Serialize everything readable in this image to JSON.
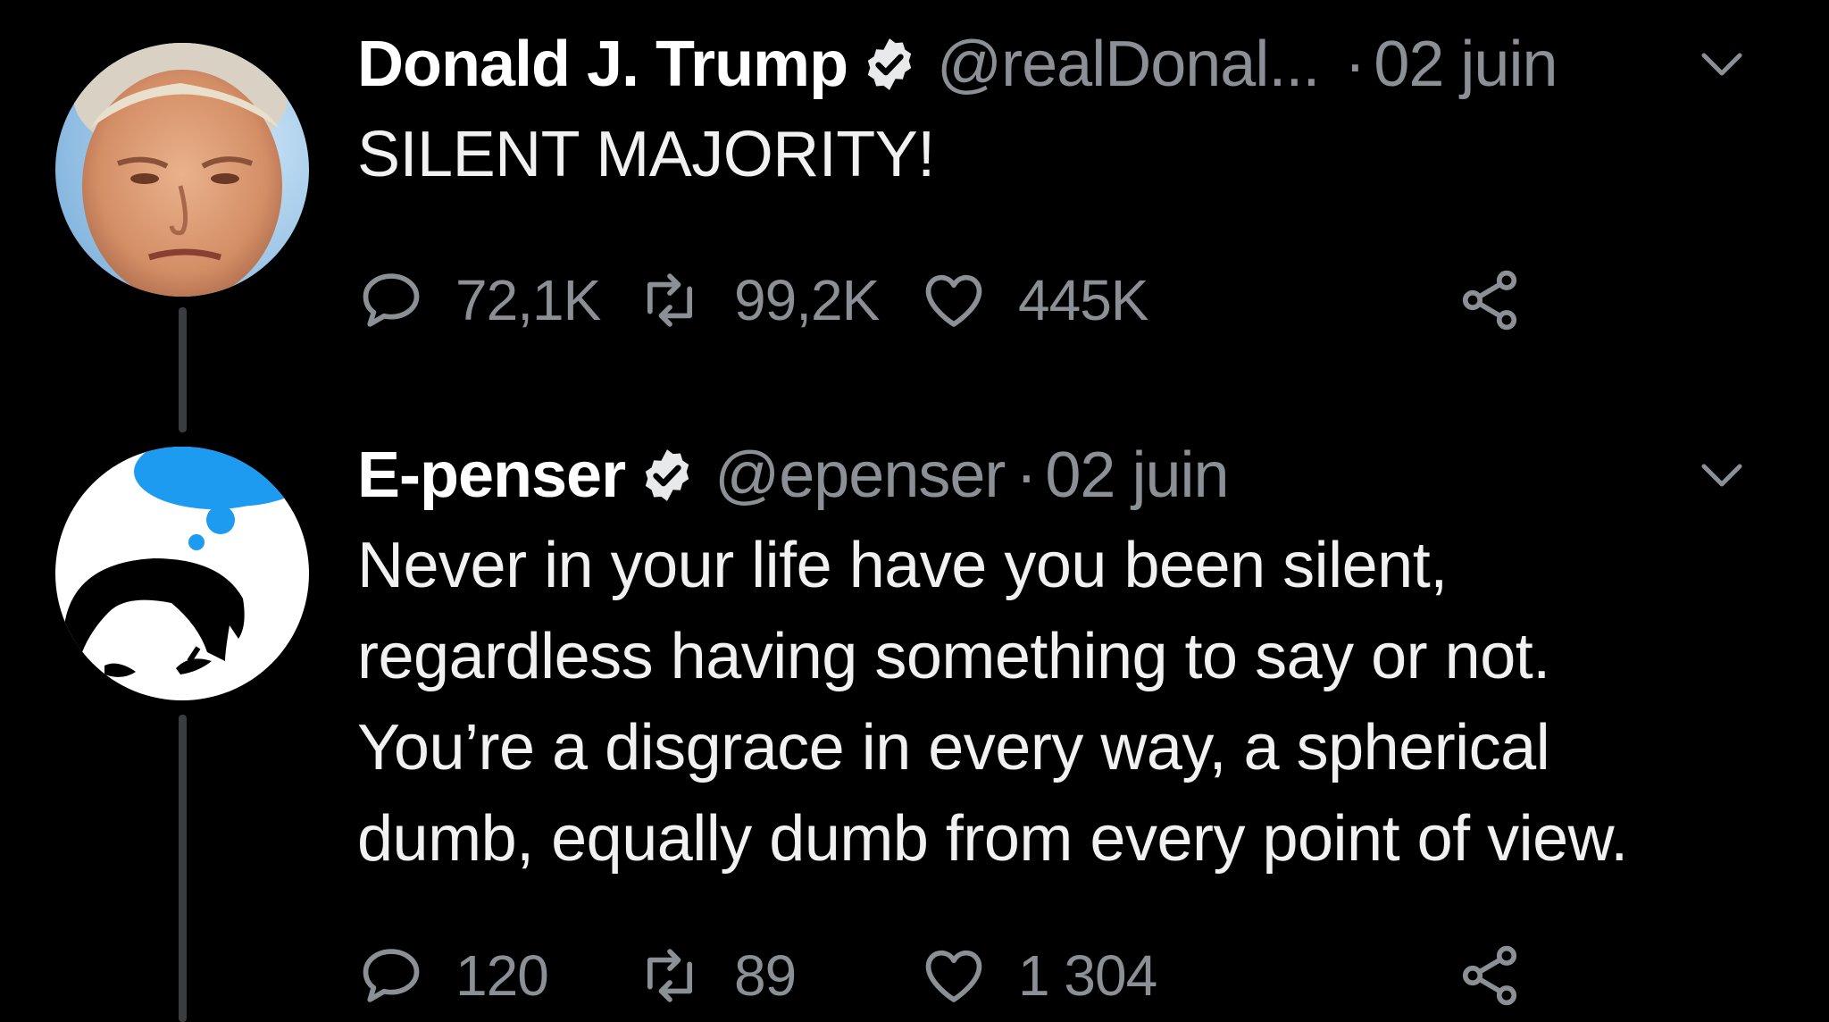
{
  "tweets": [
    {
      "display_name": "Donald J. Trump",
      "handle": "@realDonal...",
      "separator": "·",
      "date": "02 juin",
      "text": "SILENT MAJORITY!",
      "replies": "72,1K",
      "retweets": "99,2K",
      "likes": "445K"
    },
    {
      "display_name": "E-penser",
      "handle": "@epenser",
      "separator": "·",
      "date": "02 juin",
      "text_lines": [
        "Never in your life have you been silent,",
        "regardless having something to say or not.",
        "You’re a disgrace in every way, a spherical",
        "dumb, equally dumb from every point of view."
      ],
      "replies": "120",
      "retweets": "89",
      "likes": "1 304"
    }
  ],
  "icons": {
    "verified": "verified-badge-icon",
    "caret": "chevron-down-icon",
    "reply": "reply-bubble-icon",
    "retweet": "retweet-icon",
    "like": "heart-icon",
    "share": "share-icon"
  },
  "colors": {
    "background": "#000000",
    "secondary_text": "#8b9096",
    "primary_text": "#f1f1f1",
    "thread_line": "#3a3d40"
  }
}
